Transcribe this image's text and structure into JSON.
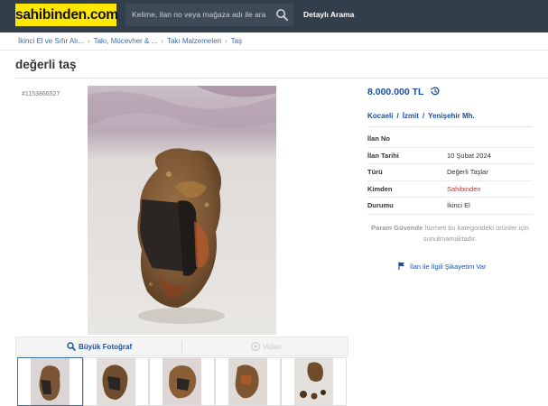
{
  "header": {
    "logo": "sahibinden.com",
    "search_placeholder": "Kelime, ilan no veya mağaza adı ile ara",
    "advanced_search": "Detaylı Arama"
  },
  "breadcrumb": [
    "İkinci El ve Sıfır Alı...",
    "Takı, Mücevher & ...",
    "Takı Malzemeleri",
    "Taş"
  ],
  "listing": {
    "title": "değerli taş",
    "ad_id": "#1153866527",
    "price": "8.000.000 TL",
    "location": [
      "Kocaeli",
      "İzmit",
      "Yenişehir Mh."
    ],
    "details": [
      {
        "label": "İlan No",
        "value": ""
      },
      {
        "label": "İlan Tarihi",
        "value": "10 Şubat 2024"
      },
      {
        "label": "Türü",
        "value": "Değerli Taşlar"
      },
      {
        "label": "Kimden",
        "value": "Sahibinden"
      },
      {
        "label": "Durumu",
        "value": "İkinci El"
      }
    ],
    "secure_pay_bold": "Param Güvende",
    "secure_pay_text": " hizmeti bu kategorideki ürünler için sunulmamaktadır.",
    "complaint": "İlan ile İlgili Şikayetim Var"
  },
  "gallery": {
    "big_photo": "Büyük Fotoğraf",
    "video": "Video",
    "thumbnails": [
      "stone-photo-1",
      "stone-photo-2",
      "stone-photo-3",
      "stone-photo-4",
      "stone-photo-5"
    ]
  },
  "colors": {
    "header_bg": "#333e4b",
    "logo_bg": "#ffe800",
    "link_blue": "#1d4f9b",
    "seller_red": "#c9302c"
  }
}
